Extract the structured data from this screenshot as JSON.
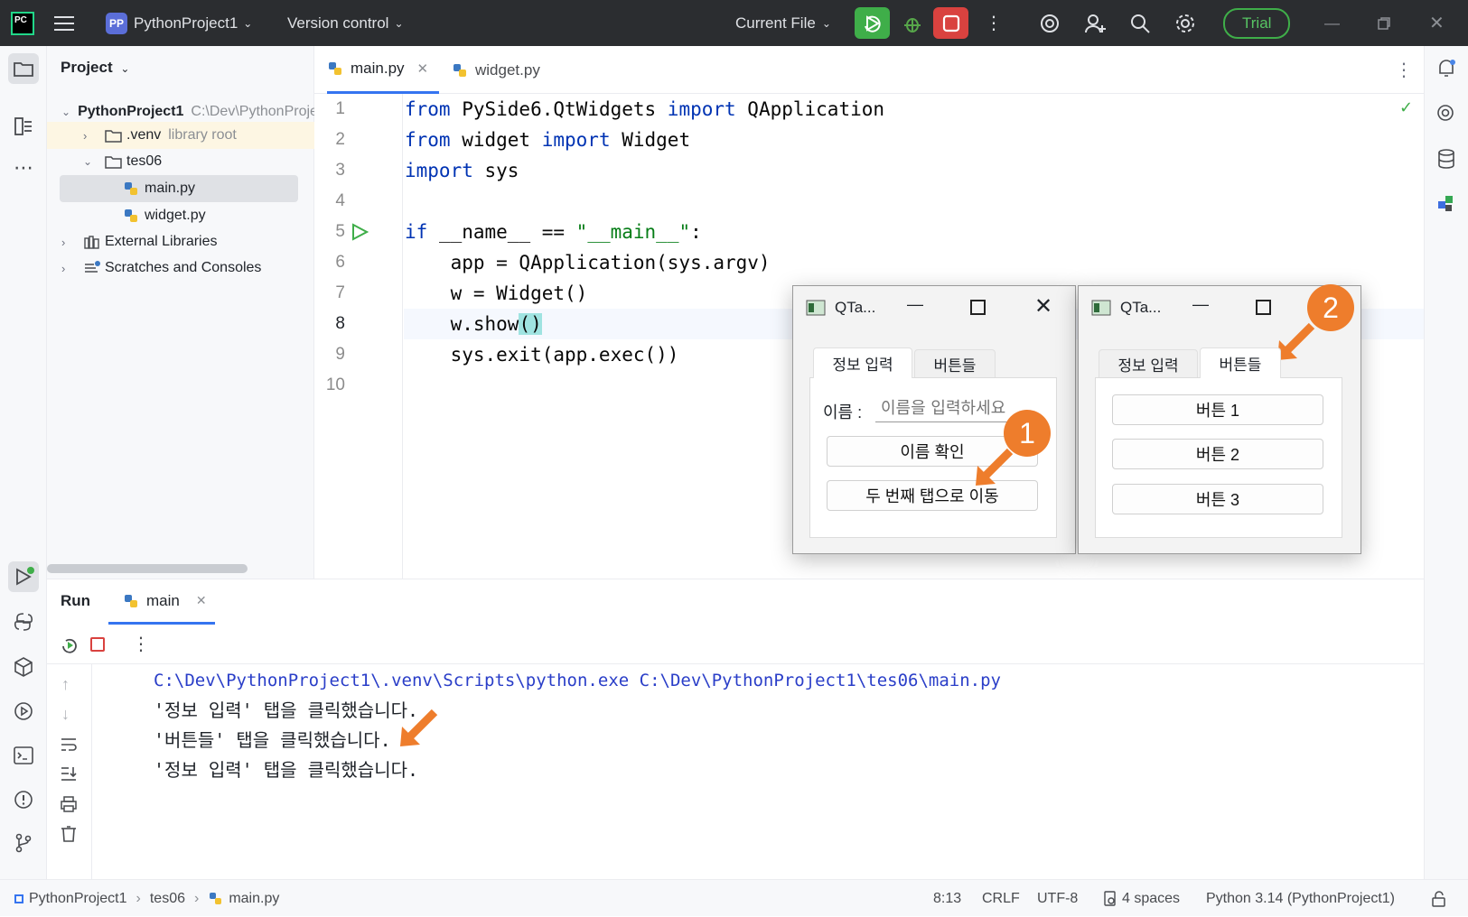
{
  "titlebar": {
    "project_badge": "PP",
    "project_name": "PythonProject1",
    "version_control": "Version control",
    "run_config": "Current File",
    "trial": "Trial",
    "logo_text": "PC"
  },
  "project_panel": {
    "title": "Project",
    "items": [
      {
        "label": "PythonProject1",
        "hint": "C:\\Dev\\PythonProject1"
      },
      {
        "label": ".venv",
        "hint": "library root"
      },
      {
        "label": "tes06",
        "hint": ""
      },
      {
        "label": "main.py",
        "hint": ""
      },
      {
        "label": "widget.py",
        "hint": ""
      },
      {
        "label": "External Libraries",
        "hint": ""
      },
      {
        "label": "Scratches and Consoles",
        "hint": ""
      }
    ]
  },
  "editor": {
    "tabs": [
      {
        "label": "main.py"
      },
      {
        "label": "widget.py"
      }
    ],
    "line_numbers": [
      "1",
      "2",
      "3",
      "4",
      "5",
      "6",
      "7",
      "8",
      "9",
      "10"
    ],
    "code": {
      "l1": {
        "a": "from",
        "b": " PySide6.QtWidgets ",
        "c": "import",
        "d": " QApplication"
      },
      "l2": {
        "a": "from",
        "b": " widget ",
        "c": "import",
        "d": " Widget"
      },
      "l3": {
        "a": "import",
        "b": " sys"
      },
      "l5": {
        "a": "if",
        "b": " __name__ == ",
        "c": "\"__main__\"",
        "d": ":"
      },
      "l6": "    app = QApplication(sys.argv)",
      "l7": "    w = Widget()",
      "l8a": "    w.show",
      "l8b": "()",
      "l9": "    sys.exit(app.exec())"
    }
  },
  "qt_window_1": {
    "title": "QTa...",
    "tabs": [
      "정보 입력",
      "버튼들"
    ],
    "name_label": "이름 :",
    "name_placeholder": "이름을 입력하세요",
    "check_button": "이름 확인",
    "move_button": "두 번째 탭으로 이동",
    "badge": "1"
  },
  "qt_window_2": {
    "title": "QTa...",
    "tabs": [
      "정보 입력",
      "버튼들"
    ],
    "buttons": [
      "버튼 1",
      "버튼 2",
      "버튼 3"
    ],
    "badge": "2"
  },
  "run_panel": {
    "title": "Run",
    "tab": "main",
    "output": [
      "C:\\Dev\\PythonProject1\\.venv\\Scripts\\python.exe C:\\Dev\\PythonProject1\\tes06\\main.py",
      "'정보 입력' 탭을 클릭했습니다.",
      "'버튼들' 탭을 클릭했습니다.",
      "'정보 입력' 탭을 클릭했습니다."
    ]
  },
  "statusbar": {
    "breadcrumb": [
      "PythonProject1",
      "tes06",
      "main.py"
    ],
    "position": "8:13",
    "line_sep": "CRLF",
    "encoding": "UTF-8",
    "indent": "4 spaces",
    "interpreter": "Python 3.14 (PythonProject1)"
  },
  "colors": {
    "accent_orange": "#ee7d2c",
    "run_green": "#3fae49",
    "stop_red": "#d9423f",
    "keyword": "#0033b3",
    "string": "#067d17"
  }
}
